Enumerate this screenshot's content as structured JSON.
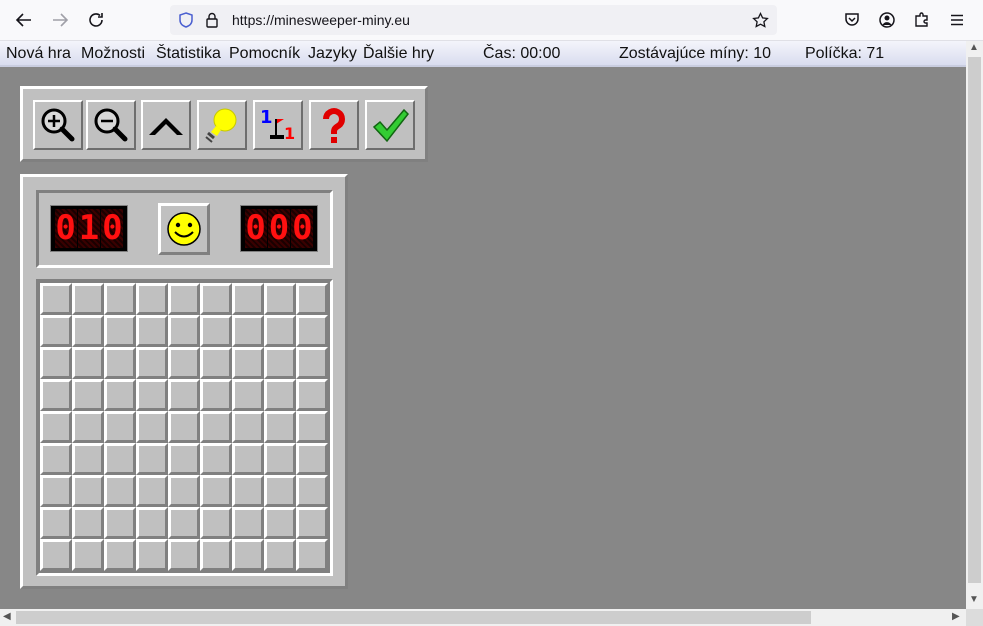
{
  "browser": {
    "url": "https://minesweeper-miny.eu",
    "url_host": "minesweeper-miny.eu",
    "url_scheme": "https://"
  },
  "menu": {
    "new_game": "Nová hra",
    "options": "Možnosti",
    "statistics": "Štatistika",
    "helper": "Pomocník",
    "languages": "Jazyky",
    "more_games": "Ďalšie hry",
    "time": "Čas: 00:00",
    "remaining_mines": "Zostávajúce míny: 10",
    "cells": "Políčka: 71"
  },
  "toolbar": {
    "icons": [
      "zoom-in-icon",
      "zoom-out-icon",
      "chevron-up-icon",
      "lightbulb-icon",
      "numbers-flag-icon",
      "question-mark-icon",
      "checkmark-icon"
    ]
  },
  "game": {
    "mine_counter": [
      "0",
      "1",
      "0"
    ],
    "timer": [
      "0",
      "0",
      "0"
    ],
    "face": "smiley",
    "rows": 9,
    "cols": 9
  },
  "colors": {
    "panel": "#c0c0c0",
    "background": "#878787",
    "lcd_digit": "#ff1010"
  }
}
